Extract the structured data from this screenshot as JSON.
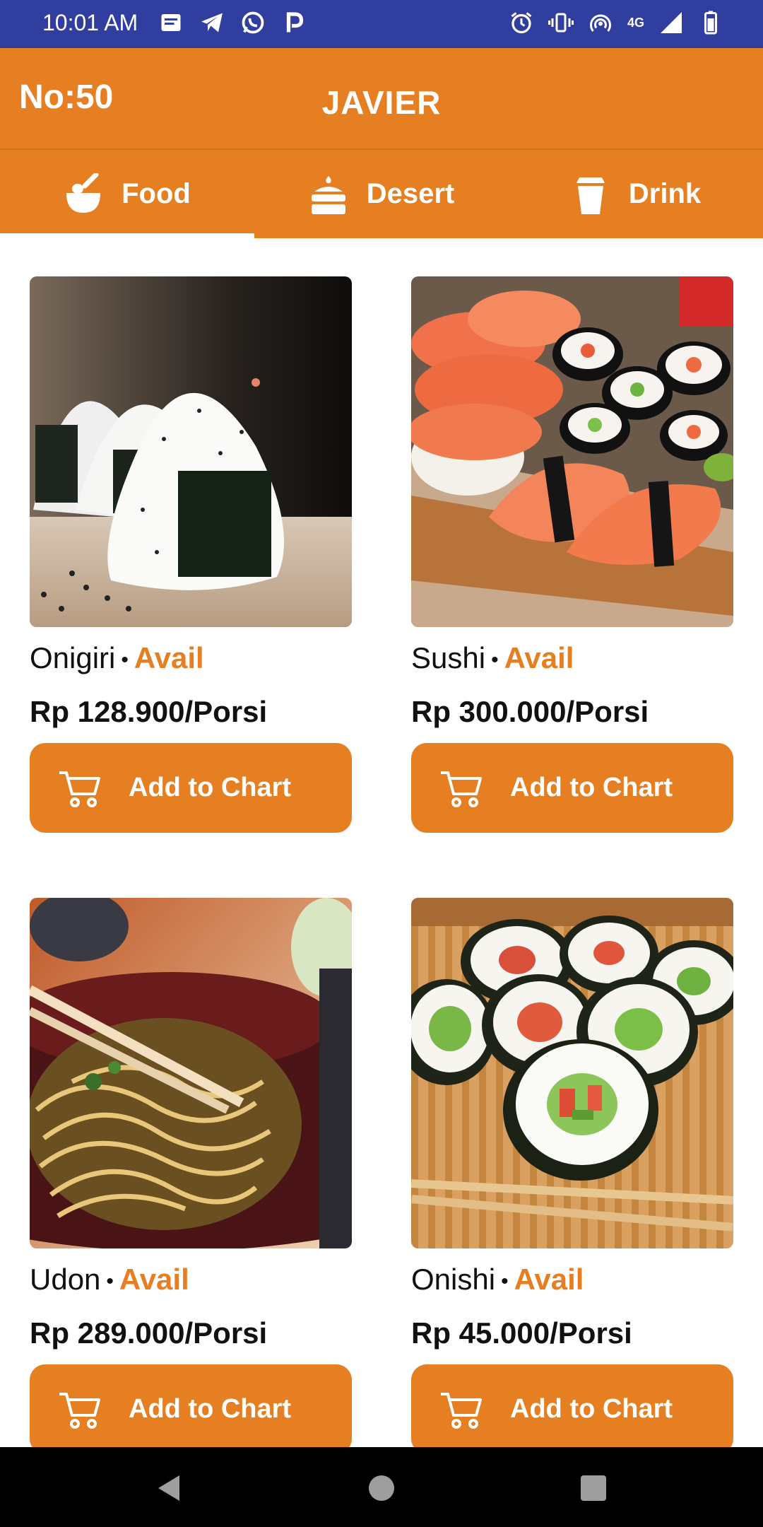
{
  "status_bar": {
    "time": "10:01 AM",
    "network": "4G",
    "icons": [
      "notes-icon",
      "telegram-icon",
      "whatsapp-icon",
      "p-app-icon",
      "alarm-icon",
      "vibrate-icon",
      "hotspot-icon",
      "signal-icon",
      "battery-icon"
    ]
  },
  "header": {
    "table_number": "No:50",
    "title": "JAVIER"
  },
  "tabs": [
    {
      "label": "Food",
      "icon": "bowl-icon",
      "selected": true
    },
    {
      "label": "Desert",
      "icon": "cake-icon",
      "selected": false
    },
    {
      "label": "Drink",
      "icon": "cup-icon",
      "selected": false
    }
  ],
  "products": [
    {
      "name": "Onigiri",
      "status": "Avail",
      "price": "Rp 128.900/Porsi",
      "button": "Add to Chart",
      "image": "onigiri-image"
    },
    {
      "name": "Sushi",
      "status": "Avail",
      "price": "Rp 300.000/Porsi",
      "button": "Add to Chart",
      "image": "sushi-image"
    },
    {
      "name": "Udon",
      "status": "Avail",
      "price": "Rp 289.000/Porsi",
      "button": "Add to Chart",
      "image": "udon-image"
    },
    {
      "name": "Onishi",
      "status": "Avail",
      "price": "Rp 45.000/Porsi",
      "button": "Add to Chart",
      "image": "onishi-image"
    }
  ],
  "separator": "•",
  "colors": {
    "status_bar": "#303f9f",
    "accent": "#e67e22",
    "text": "#111111",
    "nav_bar": "#000000"
  }
}
